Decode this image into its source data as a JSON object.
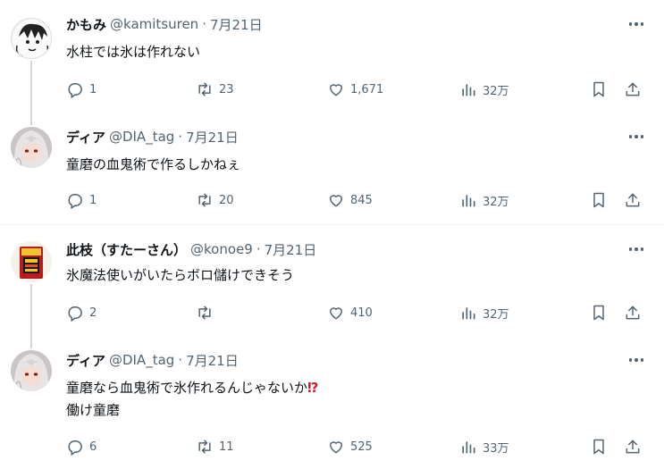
{
  "tweets": [
    {
      "name": "かもみ",
      "handle": "@kamitsuren",
      "date": "7月21日",
      "text_lines": [
        "水柱では氷は作れない"
      ],
      "replies": "1",
      "retweets": "23",
      "likes": "1,671",
      "views": "32万"
    },
    {
      "name": "ディア",
      "handle": "@DIA_tag",
      "date": "7月21日",
      "text_lines": [
        "童磨の血鬼術で作るしかねぇ"
      ],
      "replies": "1",
      "retweets": "20",
      "likes": "845",
      "views": "32万"
    },
    {
      "name": "此枝（すたーさん）",
      "handle": "@konoe9",
      "date": "7月21日",
      "text_lines": [
        "氷魔法使いがいたらボロ儲けできそう"
      ],
      "replies": "2",
      "retweets": "",
      "likes": "410",
      "views": "32万"
    },
    {
      "name": "ディア",
      "handle": "@DIA_tag",
      "date": "7月21日",
      "text_lines": [
        "童磨なら血鬼術で氷作れるんじゃないか",
        "働け童磨"
      ],
      "emoji": "⁉",
      "replies": "6",
      "retweets": "11",
      "likes": "525",
      "views": "33万"
    }
  ],
  "separator_dot": "·",
  "icons": {
    "reply": "reply-icon",
    "retweet": "retweet-icon",
    "like": "heart-icon",
    "views": "views-icon",
    "bookmark": "bookmark-icon",
    "share": "share-icon",
    "more": "more-icon"
  },
  "colors": {
    "text": "#0f1419",
    "secondary": "#536471",
    "thread_line": "#cfd9de",
    "divider": "#eff3f4"
  }
}
